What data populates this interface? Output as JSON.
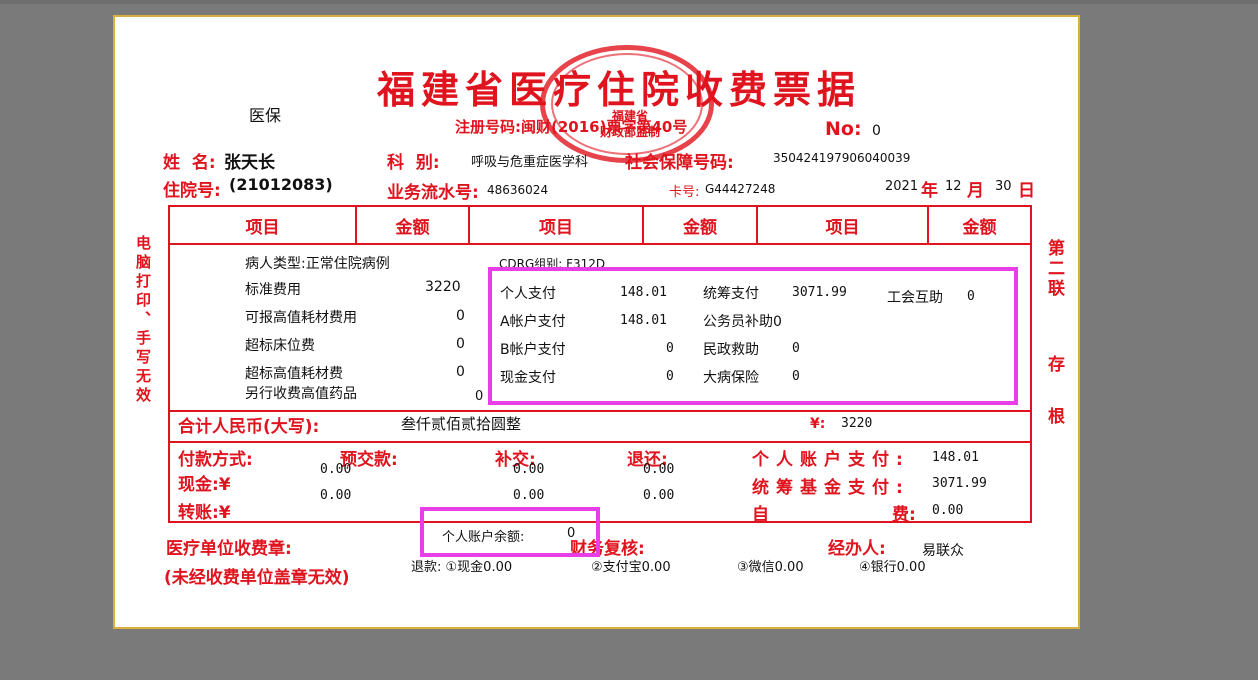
{
  "title": "福建省医疗住院收费票据",
  "header": {
    "insurance_type": "医保",
    "registration": "注册号码:闽财(2016)票字第40号",
    "no_label": "No:",
    "no_value": "0",
    "name_label": "姓  名:",
    "name_value": "张天长",
    "dept_label": "科  别:",
    "dept_value": "呼吸与危重症医学科",
    "ssn_label": "社会保障号码:",
    "ssn_value": "350424197906040039",
    "admission_label": "住院号:",
    "admission_value": "(21012083)",
    "serial_label": "业务流水号:",
    "serial_value": "48636024",
    "card_label": "卡号:",
    "card_value": "G44427248",
    "year": "2021",
    "year_unit": "年",
    "month": "12",
    "month_unit": "月",
    "day": "30",
    "day_unit": "日"
  },
  "stamp": {
    "year": "2016",
    "line1": "福建省",
    "line2": "财政部监制"
  },
  "table_headers": [
    "项目",
    "金额",
    "项目",
    "金额",
    "项目",
    "金额"
  ],
  "details": {
    "patient_type": "病人类型:正常住院病例",
    "cdrg": "CDRG组别: F312D",
    "std_fee_label": "标准费用",
    "std_fee_value": "3220",
    "hv_label": "可报高值耗材费用",
    "hv_value": "0",
    "bed_label": "超标床位费",
    "bed_value": "0",
    "over_hv_label": "超标高值耗材费",
    "over_hv_value": "0",
    "extra_drug_label": "另行收费高值药品",
    "extra_drug_value": "0"
  },
  "payments": {
    "personal_label": "个人支付",
    "personal_value": "148.01",
    "a_account_label": "A帐户支付",
    "a_account_value": "148.01",
    "b_account_label": "B帐户支付",
    "b_account_value": "0",
    "cash_label": "现金支付",
    "cash_value": "0",
    "pooled_label": "统筹支付",
    "pooled_value": "3071.99",
    "civil_label": "公务员补助0",
    "welfare_label": "民政救助",
    "welfare_value": "0",
    "serious_label": "大病保险",
    "serious_value": "0",
    "union_label": "工会互助",
    "union_value": "0"
  },
  "total": {
    "label": "合计人民币(大写):",
    "words": "叁仟贰佰贰拾圆整",
    "symbol": "¥:",
    "value": "3220"
  },
  "settlement": {
    "method_label": "付款方式:",
    "prepay_label": "预交款:",
    "supplement_label": "补交:",
    "refund_label": "退还:",
    "cash_label": "现金:¥",
    "transfer_label": "转账:¥",
    "prepay_cash": "0.00",
    "prepay_transfer": "0.00",
    "supp_cash": "0.00",
    "supp_transfer": "0.00",
    "refund_cash": "0.00",
    "refund_transfer": "0.00",
    "personal_account_label": "个人账户支付:",
    "personal_account_value": "148.01",
    "pooled_fund_label": "统筹基金支付:",
    "pooled_fund_value": "3071.99",
    "self_label_a": "自",
    "self_label_b": "费:",
    "self_value": "0.00"
  },
  "footer": {
    "seal_label": "医疗单位收费章:",
    "seal_note": "(未经收费单位盖章无效)",
    "balance_label": "个人账户余额:",
    "balance_value": "0",
    "review_label": "财务复核:",
    "operator_label": "经办人:",
    "operator_value": "易联众",
    "refund_line": "退款: ①现金0.00",
    "alipay": "②支付宝0.00",
    "wechat": "③微信0.00",
    "bank": "④银行0.00"
  },
  "left_note": "电脑打印、手写无效",
  "right_note_top": "第二联",
  "right_note_mid": "存",
  "right_note_bot": "根",
  "colors": {
    "red": "#e0141e",
    "highlight": "#e83ee8",
    "border": "#d9b13a"
  }
}
